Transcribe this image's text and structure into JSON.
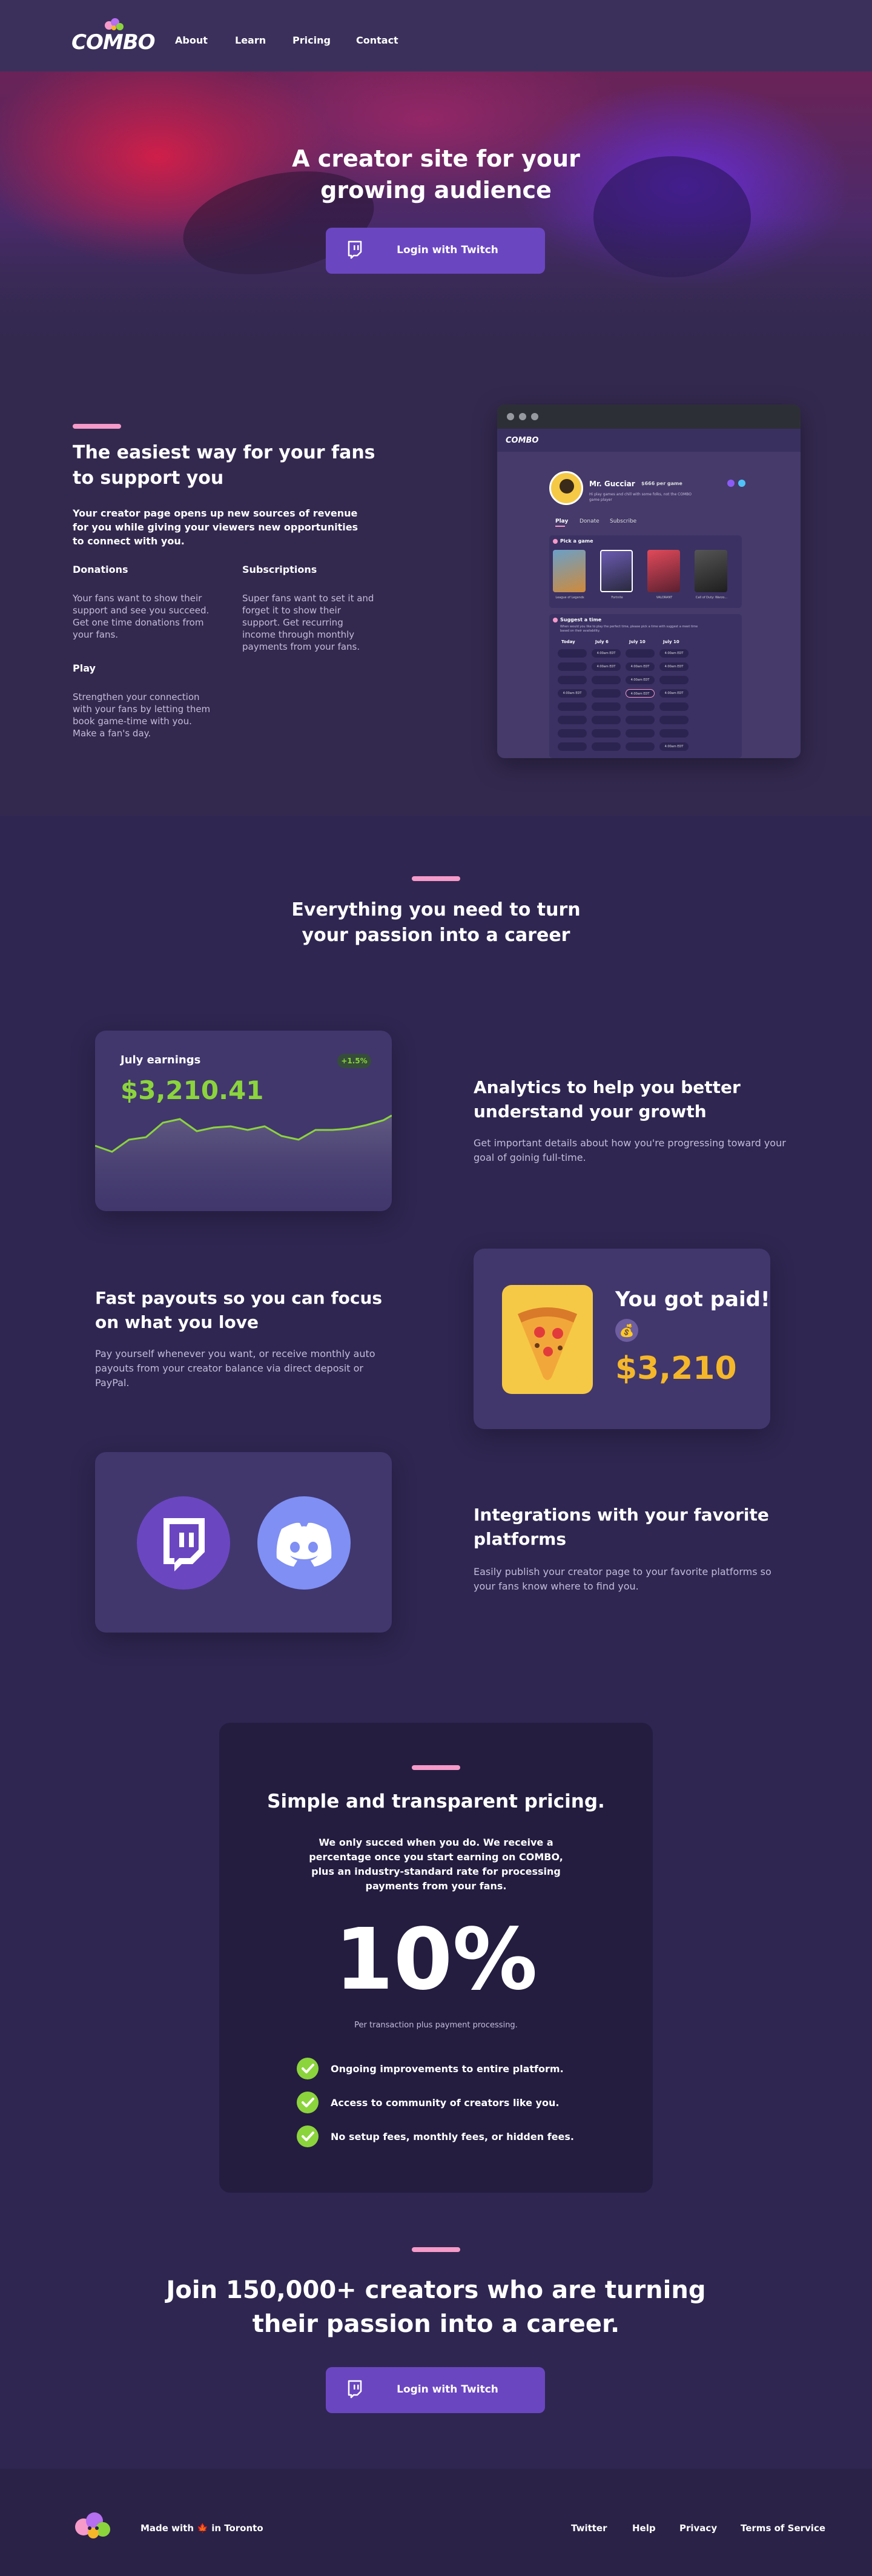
{
  "nav": {
    "logo_text": "COMBO",
    "links": [
      "About",
      "Learn",
      "Pricing",
      "Contact"
    ]
  },
  "hero": {
    "title": "A creator site for your growing audience",
    "cta": "Login with Twitch"
  },
  "support": {
    "title": "The easiest way for your fans to support you",
    "intro": "Your creator page opens up new sources of revenue for you while giving your viewers new opportunities to connect with you.",
    "features": [
      {
        "title": "Donations",
        "text": "Your fans want to show their support and see you succeed. Get one time donations from your fans."
      },
      {
        "title": "Subscriptions",
        "text": "Super fans want to set it and forget it to show their support. Get recurring income through monthly payments from your fans."
      },
      {
        "title": "Play",
        "text": "Strengthen your connection with your fans by letting them book game-time with you. Make a fan's day."
      }
    ]
  },
  "mockup": {
    "logo": "COMBO",
    "name": "Mr. Gucciar",
    "price": "$666 per game",
    "bio": "Hi play games and chill with some folks, not the COMBO game player",
    "tabs": [
      "Play",
      "Donate",
      "Subscribe"
    ],
    "pick_game": "Pick a game",
    "games": [
      "League of Legends",
      "Fortnite",
      "VALORANT",
      "Call of Duty: Warzo..."
    ],
    "suggest_time": "Suggest a time",
    "suggest_text": "When would you like to play the perfect time, please pick a time with suggest a meet time based on their availability.",
    "days": [
      "Today",
      "July 6",
      "July 10",
      "July 10"
    ],
    "slot": "4:00am EDT"
  },
  "career": {
    "title": "Everything you need to turn your passion into a career"
  },
  "analytics": {
    "card_label": "July earnings",
    "card_badge": "+1.5%",
    "card_value": "$3,210.41",
    "title": "Analytics to help you better understand your growth",
    "text": "Get important details about how you're progressing toward your goal of goinig full-time."
  },
  "payouts": {
    "title": "Fast payouts so you can focus on what you love",
    "text": "Pay yourself whenever you want, or receive monthly auto payouts from your creator balance via direct deposit or PayPal.",
    "card_title": "You got paid!",
    "card_value": "$3,210"
  },
  "integrations": {
    "title": "Integrations with your favorite platforms",
    "text": "Easily publish your creator page to your favorite platforms so your fans know where to find you."
  },
  "pricing": {
    "title": "Simple and transparent pricing.",
    "text": "We only succed when you do. We receive a percentage once you start earning on COMBO, plus an industry-standard rate for processing payments from your fans.",
    "percent": "10%",
    "note": "Per transaction plus payment processing.",
    "items": [
      "Ongoing improvements to entire platform.",
      "Access to community of creators like you.",
      "No setup fees, monthly fees, or hidden fees."
    ]
  },
  "join": {
    "title": "Join 150,000+ creators who are turning their passion into a career.",
    "cta": "Login with Twitch"
  },
  "footer": {
    "made_with_pre": "Made with",
    "made_with_post": "in Toronto",
    "links": [
      "Twitter",
      "Help",
      "Privacy",
      "Terms of Service"
    ]
  },
  "colors": {
    "background": "#33294f",
    "accent_pink": "#f59ac9",
    "twitch_purple": "#6b46c1",
    "money_green": "#8bd43c",
    "gold": "#f5b72a",
    "discord_blue": "#7f8ff4"
  }
}
